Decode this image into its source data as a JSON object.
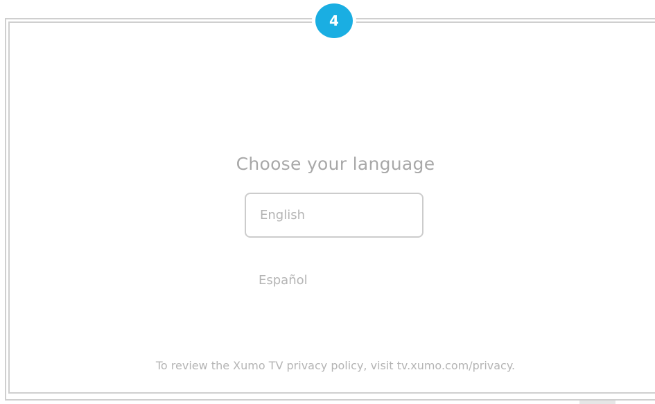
{
  "step": {
    "number": "4"
  },
  "language_screen": {
    "title": "Choose your language",
    "options": [
      {
        "label": "English",
        "selected": true
      },
      {
        "label": "Español",
        "selected": false
      }
    ]
  },
  "footer": {
    "privacy_text": "To review the Xumo TV privacy policy, visit tv.xumo.com/privacy."
  },
  "colors": {
    "accent": "#1aaee2",
    "frame": "#cfcfcf",
    "text": "#a8a8a8"
  }
}
